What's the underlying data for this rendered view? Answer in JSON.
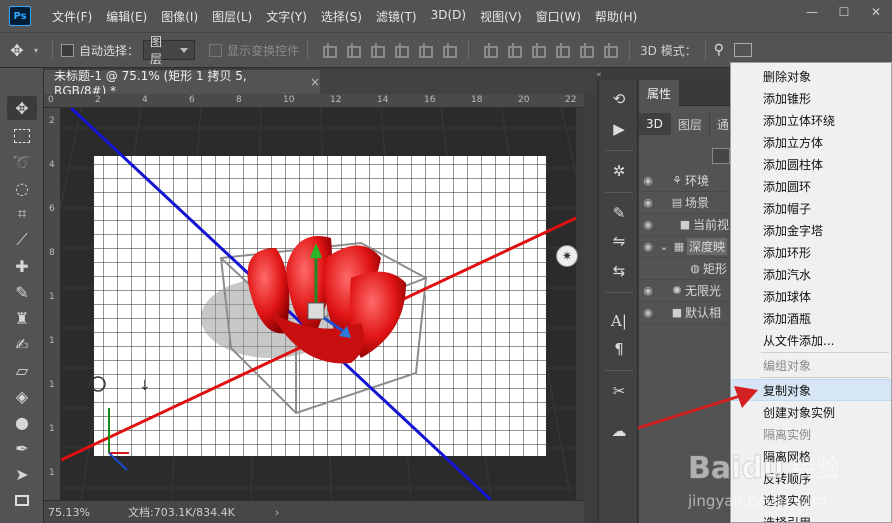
{
  "app": {
    "logo": "Ps"
  },
  "menu": [
    "文件(F)",
    "编辑(E)",
    "图像(I)",
    "图层(L)",
    "文字(Y)",
    "选择(S)",
    "滤镜(T)",
    "3D(D)",
    "视图(V)",
    "窗口(W)",
    "帮助(H)"
  ],
  "window_controls": [
    "—",
    "☐",
    "✕"
  ],
  "options": {
    "auto_select_label": "自动选择：",
    "auto_select_value": "图层",
    "show_transform_label": "显示变换控件",
    "mode_label": "3D 模式："
  },
  "document": {
    "tab_title": "未标题-1 @ 75.1% (矩形 1 拷贝 5, RGB/8#) *",
    "close_glyph": "×",
    "zoom": "75.13%",
    "doc_size": "文档:703.1K/834.4K",
    "status_arrow": "›"
  },
  "rulers": {
    "top": [
      "0",
      "2",
      "4",
      "6",
      "8",
      "10",
      "12",
      "14",
      "16",
      "18",
      "20",
      "22"
    ],
    "left": [
      "2",
      "4",
      "6",
      "8",
      "1",
      "1",
      "1",
      "1",
      "1"
    ]
  },
  "properties": {
    "title": "属性",
    "tabs": [
      "3D",
      "图层",
      "通"
    ],
    "scene_rows": [
      "环境",
      "场景",
      "当前视",
      "深度映",
      "矩形",
      "无限光",
      "默认相"
    ]
  },
  "context_menu": {
    "items": [
      {
        "label": "删除对象",
        "disabled": false
      },
      {
        "label": "添加锥形",
        "disabled": false
      },
      {
        "label": "添加立体环绕",
        "disabled": false
      },
      {
        "label": "添加立方体",
        "disabled": false
      },
      {
        "label": "添加圆柱体",
        "disabled": false
      },
      {
        "label": "添加圆环",
        "disabled": false
      },
      {
        "label": "添加帽子",
        "disabled": false
      },
      {
        "label": "添加金字塔",
        "disabled": false
      },
      {
        "label": "添加环形",
        "disabled": false
      },
      {
        "label": "添加汽水",
        "disabled": false
      },
      {
        "label": "添加球体",
        "disabled": false
      },
      {
        "label": "添加酒瓶",
        "disabled": false
      },
      {
        "label": "从文件添加...",
        "disabled": false
      },
      {
        "label": "编组对象",
        "disabled": true
      },
      {
        "label": "复制对象",
        "disabled": false,
        "hover": true
      },
      {
        "label": "创建对象实例",
        "disabled": false
      },
      {
        "label": "隔离实例",
        "disabled": true
      },
      {
        "label": "隔离网格",
        "disabled": false
      },
      {
        "label": "反转顺序",
        "disabled": false
      },
      {
        "label": "选择实例",
        "disabled": false
      },
      {
        "label": "选择引用",
        "disabled": false
      }
    ]
  },
  "watermark": {
    "brand": "Baidu",
    "sub": "经验",
    "url": "jingyan.baidu.com"
  },
  "colors": {
    "accent_blue": "#31a8ff",
    "axis_red": "#e01010",
    "axis_blue": "#1010d0",
    "arrow_red": "#d42020"
  }
}
